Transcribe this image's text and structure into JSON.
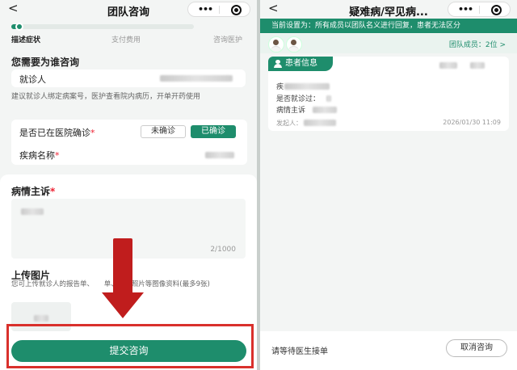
{
  "left": {
    "title": "团队咨询",
    "back": "<",
    "capsule_more": "•••",
    "steps": [
      "描述症状",
      "支付费用",
      "咨询医护"
    ],
    "progress": 0.04,
    "who_title": "您需要为谁咨询",
    "patient_label": "就诊人",
    "patient_hint": "建议就诊人绑定病案号，医护查看院内病历，开单开药使用",
    "confirmed_label": "是否已在医院确诊",
    "req_mark": "*",
    "opt_unconfirmed": "未确诊",
    "opt_confirmed": "已确诊",
    "disease_label": "疾病名称",
    "complaint_title": "病情主诉",
    "complaint_counter": "2/1000",
    "upload_title": "上传图片",
    "upload_hint": "您可上传就诊人的报告单、　　单、患处照片等图像资料(最多9张)",
    "submit": "提交咨询"
  },
  "right": {
    "title": "疑难病/罕见病...",
    "back": "<",
    "capsule_more": "•••",
    "banner": "当前设置为：所有成员以团队名义进行回复，患者无法区分",
    "team_members": "团队成员：2位 >",
    "patient_tag": "患者信息",
    "line1_label": "疾",
    "line2_label": "是否就诊过：",
    "line3_label": "病情主诉",
    "initiator_label": "发起人：",
    "time": "2026/01/30 11:09",
    "wait_text": "请等待医生接单",
    "cancel": "取消咨询"
  }
}
